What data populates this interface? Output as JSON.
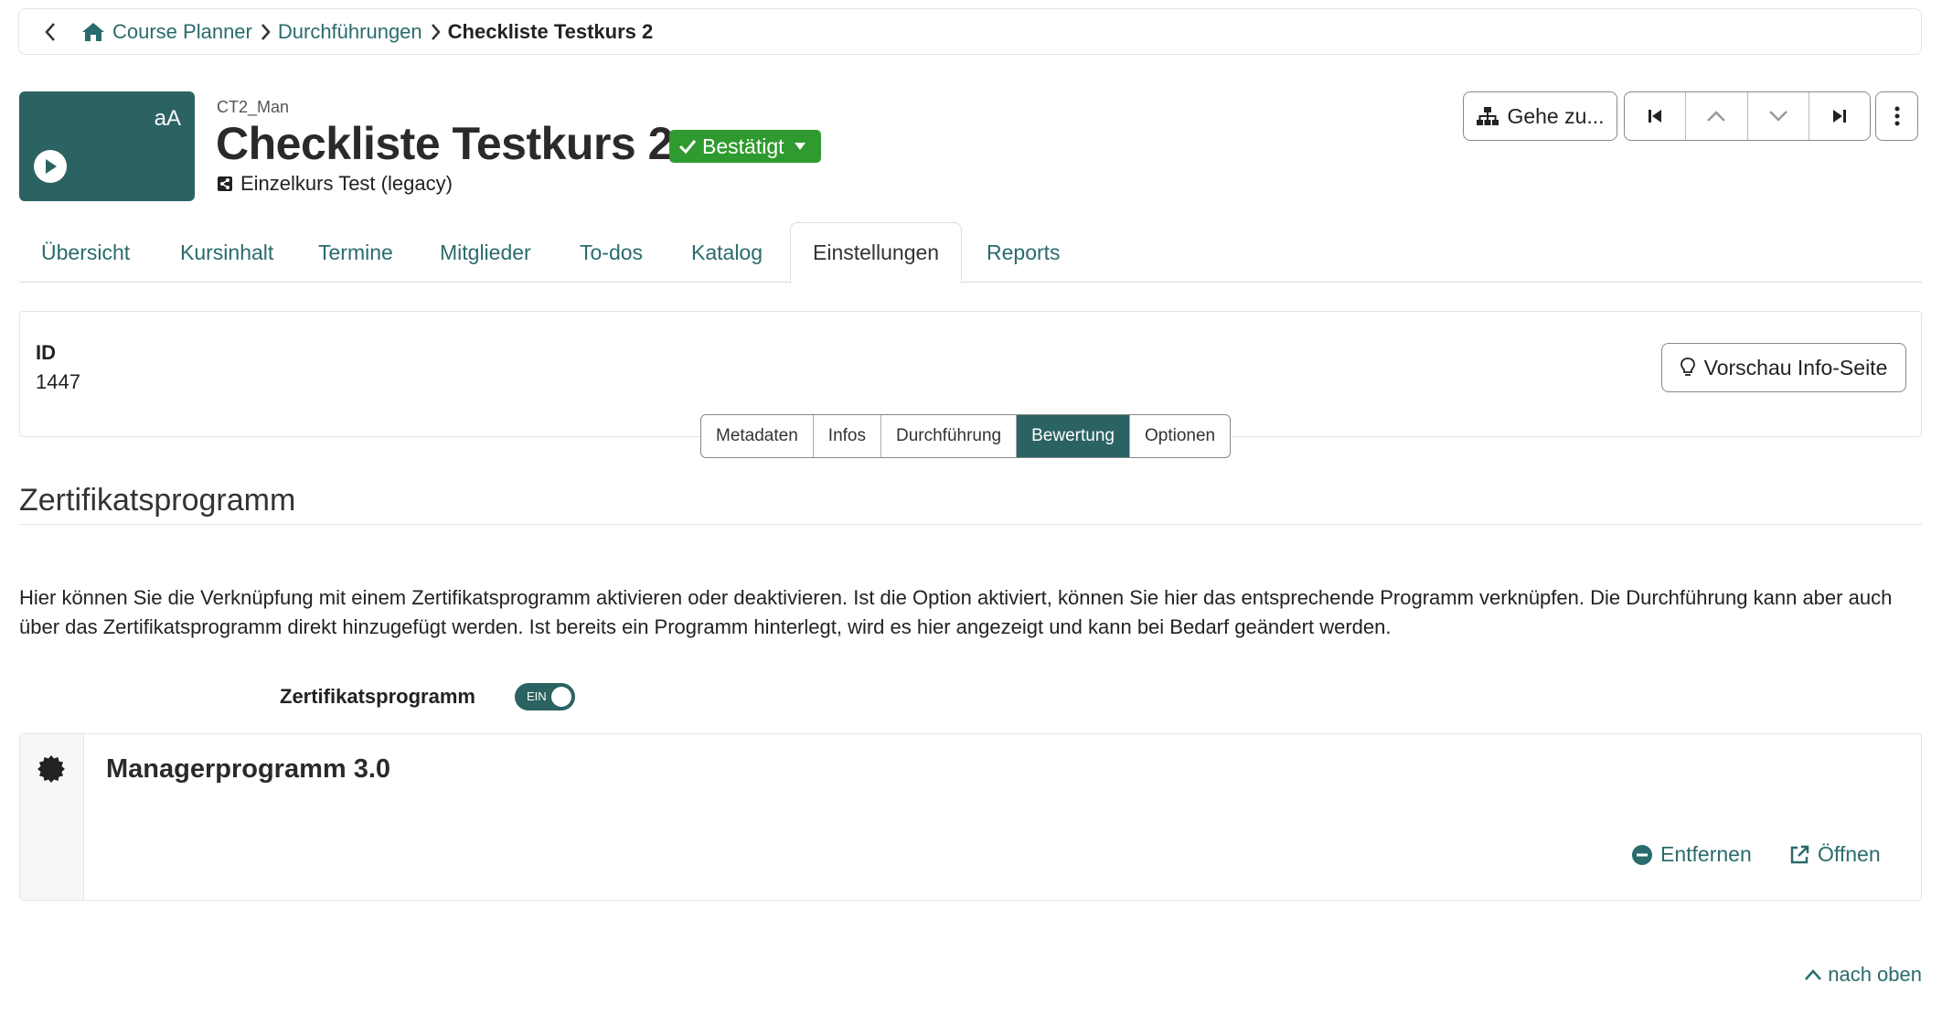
{
  "breadcrumb": {
    "items": [
      "Course Planner",
      "Durchführungen"
    ],
    "current": "Checkliste Testkurs 2"
  },
  "course": {
    "tile_text": "aA",
    "ref": "CT2_Man",
    "title": "Checkliste Testkurs 2",
    "status": "Bestätigt",
    "type": "Einzelkurs Test (legacy)"
  },
  "toolbar": {
    "goto_label": "Gehe zu..."
  },
  "tabs": [
    {
      "label": "Übersicht"
    },
    {
      "label": "Kursinhalt"
    },
    {
      "label": "Termine"
    },
    {
      "label": "Mitglieder"
    },
    {
      "label": "To-dos"
    },
    {
      "label": "Katalog"
    },
    {
      "label": "Einstellungen"
    },
    {
      "label": "Reports"
    }
  ],
  "id_panel": {
    "label": "ID",
    "value": "1447",
    "preview_label": "Vorschau Info-Seite"
  },
  "subtabs": [
    {
      "label": "Metadaten"
    },
    {
      "label": "Infos"
    },
    {
      "label": "Durchführung"
    },
    {
      "label": "Bewertung"
    },
    {
      "label": "Optionen"
    }
  ],
  "section": {
    "title": "Zertifikatsprogramm",
    "description": "Hier können Sie die Verknüpfung mit einem Zertifikatsprogramm aktivieren oder deaktivieren. Ist die Option aktiviert, können Sie hier das entsprechende Programm verknüpfen. Die Durchführung kann aber auch über das Zertifikatsprogramm direkt hinzugefügt werden. Ist bereits ein Programm hinterlegt, wird es hier angezeigt und kann bei Bedarf geändert werden.",
    "toggle_label": "Zertifikatsprogramm",
    "toggle_state": "EIN"
  },
  "program": {
    "title": "Managerprogramm 3.0",
    "remove_label": "Entfernen",
    "open_label": "Öffnen"
  },
  "back_to_top": "nach oben",
  "colors": {
    "accent": "#2b6262",
    "link": "#2a6b6b",
    "status_green": "#2f9a2f"
  }
}
